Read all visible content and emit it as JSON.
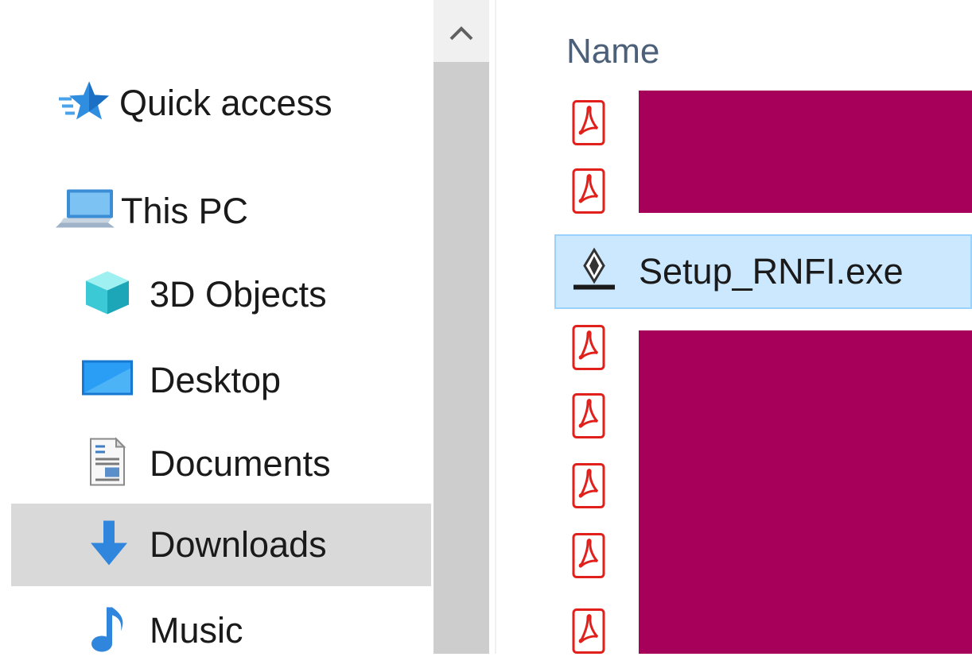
{
  "navigation": {
    "items": [
      {
        "label": "Quick access",
        "icon": "quick-access-star-icon"
      },
      {
        "label": "This PC",
        "icon": "computer-icon"
      },
      {
        "label": "3D Objects",
        "icon": "3d-objects-icon"
      },
      {
        "label": "Desktop",
        "icon": "desktop-icon"
      },
      {
        "label": "Documents",
        "icon": "documents-icon"
      },
      {
        "label": "Downloads",
        "icon": "downloads-arrow-icon",
        "selected": true
      },
      {
        "label": "Music",
        "icon": "music-note-icon"
      }
    ]
  },
  "file_list": {
    "column_name": "Name",
    "files": [
      {
        "name": "",
        "type": "pdf",
        "redacted": true
      },
      {
        "name": "",
        "type": "pdf",
        "redacted": true
      },
      {
        "name": "Setup_RNFI.exe",
        "type": "exe",
        "selected": true
      },
      {
        "name": "",
        "type": "pdf",
        "redacted": true
      },
      {
        "name": "",
        "type": "pdf",
        "redacted": true
      },
      {
        "name": "",
        "type": "pdf",
        "redacted": true
      },
      {
        "name": "",
        "type": "pdf",
        "redacted": true
      },
      {
        "name": "",
        "type": "pdf",
        "redacted": true
      }
    ]
  },
  "colors": {
    "selection_fill": "#cce8ff",
    "selection_border": "#99d1ff",
    "nav_selected": "#d9d9d9",
    "redaction": "#a7005a",
    "pdf_red": "#e1201b"
  }
}
